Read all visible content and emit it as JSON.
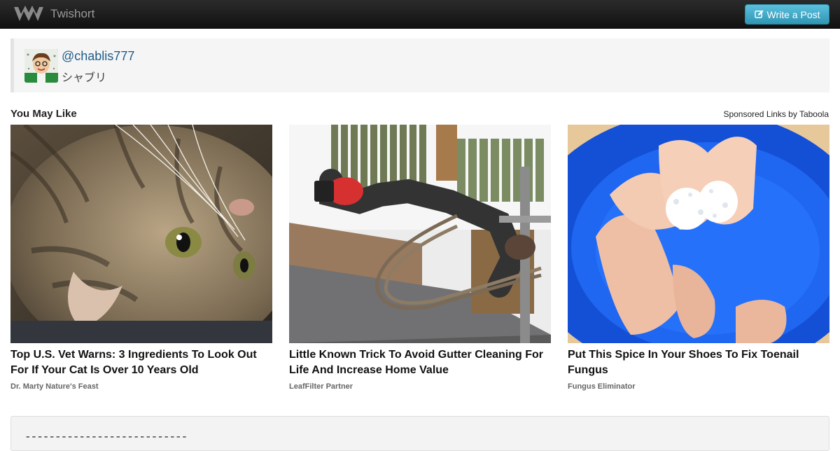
{
  "header": {
    "brand": "Twishort",
    "write_button": "Write a Post"
  },
  "author": {
    "handle": "@chablis777",
    "display_name": "シャブリ"
  },
  "recommendations": {
    "heading": "You May Like",
    "sponsored": "Sponsored Links by Taboola",
    "items": [
      {
        "title": "Top U.S. Vet Warns: 3 Ingredients To Look Out For If Your Cat Is Over 10 Years Old",
        "source": "Dr. Marty Nature's Feast"
      },
      {
        "title": "Little Known Trick To Avoid Gutter Cleaning For Life And Increase Home Value",
        "source": "LeafFilter Partner"
      },
      {
        "title": "Put This Spice In Your Shoes To Fix Toenail Fungus",
        "source": "Fungus Eliminator"
      }
    ]
  },
  "post": {
    "separator": "---------------------------"
  },
  "colors": {
    "button": "#2f96b4",
    "link": "#1e5c8a",
    "topbar": "#1a1a1a"
  }
}
